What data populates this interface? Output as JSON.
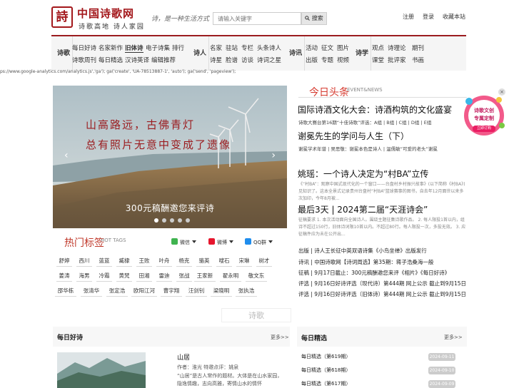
{
  "header": {
    "logo_mark": "詩",
    "site_title": "中国诗歌网",
    "site_subtitle": "诗歌高地 诗人家园",
    "slogan": "诗，是一种生活方式",
    "search_placeholder": "请输入关键字",
    "search_label": "搜索",
    "top_links": [
      "注册",
      "登录",
      "收藏本站"
    ]
  },
  "nav": {
    "sections": [
      {
        "category": "诗歌",
        "links": [
          [
            "每日好诗",
            "名家新作",
            "旧体诗",
            "电子诗集",
            "排行"
          ],
          [
            "诗歌周刊",
            "每日精选",
            "汉诗英译",
            "编辑推荐"
          ]
        ]
      },
      {
        "category": "诗人",
        "links": [
          [
            "名家",
            "驻站",
            "专栏",
            "头条诗人"
          ],
          [
            "诗星",
            "脸谱",
            "访谈",
            "诗词之星"
          ]
        ]
      },
      {
        "category": "诗讯",
        "links": [
          [
            "活动",
            "征文",
            "图片"
          ],
          [
            "出版",
            "专题",
            "视频"
          ]
        ]
      },
      {
        "category": "诗学",
        "links": [
          [
            "观点",
            "诗理论",
            "期刊"
          ],
          [
            "课堂",
            "批评家",
            "书画"
          ]
        ]
      }
    ],
    "active": "旧体诗"
  },
  "script_text": "ps://www.google-analytics.com/analytics.js','ga'); ga('create', 'UA-78513887-1', 'auto'); ga('send', 'pageview');",
  "slider": {
    "line1": "山高路远，古佛青灯",
    "line2": "总有照片无意中变成了遗像",
    "caption": "300元稿酬邀您来评诗",
    "prev": "‹",
    "next": "›",
    "slide_count": 5,
    "active_index": 0
  },
  "hot_tags": {
    "title": "热门标签",
    "title_en": "HOT TAGS",
    "share": [
      "微信",
      "微博",
      "QQ群"
    ],
    "rows": [
      [
        "舒婷",
        "西川",
        "蓝蓝",
        "臧棣",
        "王败",
        "叶舟",
        "杨克",
        "骆英",
        "嗖石",
        "宋琳",
        "树才"
      ],
      [
        "姜涛",
        "海男",
        "冷霜",
        "黄梵",
        "田湘",
        "雷迪",
        "张战",
        "王家新",
        "翟永明",
        "敬文东"
      ],
      [
        "邵华栋",
        "张清华",
        "张定浩",
        "欧阳江河",
        "曹宇翔",
        "汪剑钊",
        "梁晓明",
        "张执浩"
      ]
    ]
  },
  "poem_tab": "诗歌",
  "daily": {
    "title": "每日好诗",
    "more": "更多>>",
    "poem_title": "山居",
    "poem_meta": "作者：淮光  特邀点评：姚泉",
    "poem_excerpt": "“山居”是古人常作的题材。大体是在山水家园，隐逸情趣，志向高雅，寄情山水的情怀"
  },
  "today": {
    "title": "今日头条",
    "title_en": "EVENT&NEWS",
    "headline1": "国际诗酒文化大会：诗酒构筑的文化盛宴",
    "sub1": "诗歌大赛台第16期“十佳诗歌”评选：A组 | B组 | C组 | D组 | E组",
    "headline2": "谢冕先生的学问与人生（下）",
    "sub2": "谢冕学术年谱 | 吴思敬：谢冕本色是诗人 | 温儒敏“可爱的老头”谢冕",
    "headline3": "姚瑶：一个诗人决定为“村BA”立传",
    "snippet3": "《“村BA”：观察中国式现代化的一个窗口——台盘村乡村振兴故事》(以下简称《村BA》)见知识了。这本全景式记录贵州台盘村“村BA”篮球赛事的图书，自去年12月面世以来多次加印，今年8月被...",
    "headline4": "最后3天 | 2024第二届“天涯诗会”",
    "snippet4": "征稿要求 1. 本次活动面向全国诗人。围绕主题征集诗歌作品。 2. 每人限投1首以内，组诗不超过150行，旧体诗词限10首以内。不超过80行。每人限投一次，多投无效。 3. 应征稿件应为未在公开出...",
    "news": [
      "出版 | 诗人王长征中英双语诗集《小鸟坐禅》出版发行",
      "诗讯 | 中国诗歌网【诗词周选】第35期：蒋子浩桑海一般",
      "征稿 | 9月17日截止：300元稿酬邀您来评《相片》《每日好诗》",
      "评选 | 9月16日好诗评选（现代诗）第444期 网上公示 截止到9月15日",
      "评选 | 9月16日好诗评选（旧体诗）第444期 网上公示 截止到9月15日"
    ]
  },
  "ad": {
    "text1": "诗歌文创",
    "text2": "专属定制",
    "button": "立即订购"
  },
  "selection": {
    "title": "每日精选",
    "more": "更多>>",
    "items": [
      {
        "label": "每日精选（第619期）",
        "date": "2024-09-11"
      },
      {
        "label": "每日精选（第618期）",
        "date": "2024-09-10"
      },
      {
        "label": "每日精选（第617期）",
        "date": "2024-09-09"
      }
    ]
  },
  "colors": {
    "brand_red": "#9b1c1f",
    "headline_red": "#d63b30",
    "nav_bg": "#f5f5f5"
  }
}
